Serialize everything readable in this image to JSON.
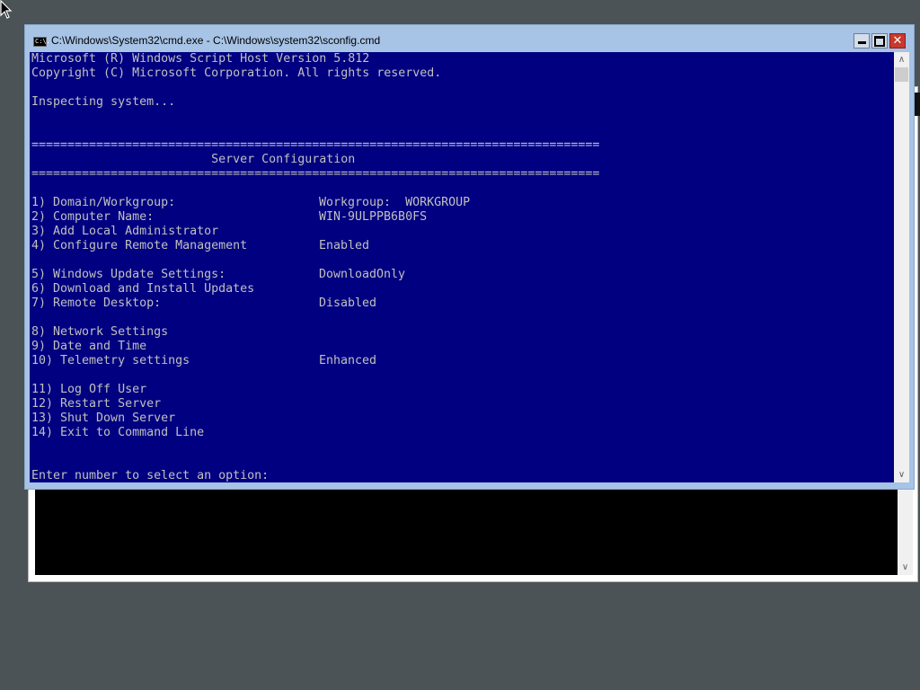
{
  "window": {
    "title": "C:\\Windows\\System32\\cmd.exe - C:\\Windows\\system32\\sconfig.cmd",
    "icon_label": "C:\\."
  },
  "console": {
    "header": [
      "Microsoft (R) Windows Script Host Version 5.812",
      "Copyright (C) Microsoft Corporation. All rights reserved.",
      "",
      "Inspecting system...",
      "",
      "",
      "===============================================================================",
      "                         Server Configuration",
      "===============================================================================",
      ""
    ],
    "menu": [
      {
        "label": "1) Domain/Workgroup:",
        "value": "Workgroup:  WORKGROUP"
      },
      {
        "label": "2) Computer Name:",
        "value": "WIN-9ULPPB6B0FS"
      },
      {
        "label": "3) Add Local Administrator",
        "value": ""
      },
      {
        "label": "4) Configure Remote Management",
        "value": "Enabled"
      },
      {
        "label": "",
        "value": ""
      },
      {
        "label": "5) Windows Update Settings:",
        "value": "DownloadOnly"
      },
      {
        "label": "6) Download and Install Updates",
        "value": ""
      },
      {
        "label": "7) Remote Desktop:",
        "value": "Disabled"
      },
      {
        "label": "",
        "value": ""
      },
      {
        "label": "8) Network Settings",
        "value": ""
      },
      {
        "label": "9) Date and Time",
        "value": ""
      },
      {
        "label": "10) Telemetry settings",
        "value": "Enhanced"
      },
      {
        "label": "",
        "value": ""
      },
      {
        "label": "11) Log Off User",
        "value": ""
      },
      {
        "label": "12) Restart Server",
        "value": ""
      },
      {
        "label": "13) Shut Down Server",
        "value": ""
      },
      {
        "label": "14) Exit to Command Line",
        "value": ""
      },
      {
        "label": "",
        "value": ""
      },
      {
        "label": "",
        "value": ""
      }
    ],
    "prompt": "Enter number to select an option:"
  },
  "colors": {
    "console_bg": "#000080",
    "console_fg": "#c0c0c0",
    "titlebar": "#a7c3e6",
    "close_button": "#c63a2e",
    "desktop": "#4c5356"
  }
}
